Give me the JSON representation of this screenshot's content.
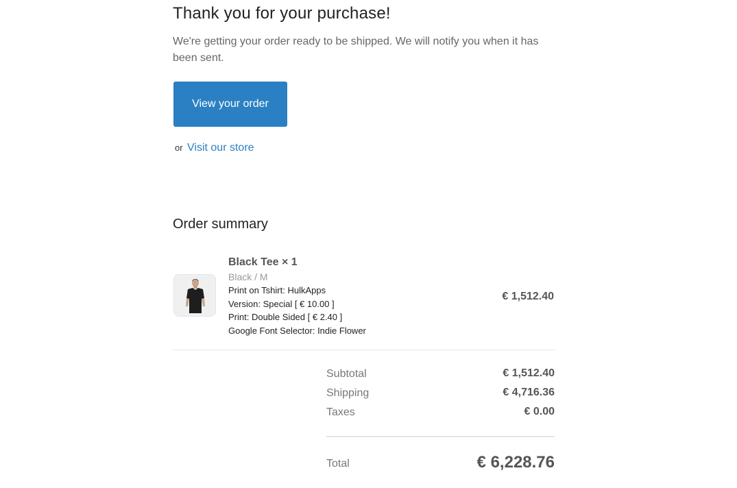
{
  "header": {
    "title": "Thank you for your purchase!",
    "message": "We're getting your order ready to be shipped. We will notify you when it has been sent."
  },
  "actions": {
    "view_order_label": "View your order",
    "or_text": "or",
    "visit_store_label": "Visit our store"
  },
  "summary": {
    "title": "Order summary",
    "items": [
      {
        "image_icon": "black-tshirt-product-image",
        "title": "Black Tee × 1",
        "variant": "Black / M",
        "properties": [
          "Print on Tshirt: HulkApps",
          "Version: Special [ € 10.00 ]",
          "Print: Double Sided [ € 2.40 ]",
          "Google Font Selector: Indie Flower"
        ],
        "price": "€ 1,512.40"
      }
    ],
    "totals": [
      {
        "label": "Subtotal",
        "value": "€ 1,512.40"
      },
      {
        "label": "Shipping",
        "value": "€ 4,716.36"
      },
      {
        "label": "Taxes",
        "value": "€ 0.00"
      }
    ],
    "grand_total": {
      "label": "Total",
      "value": "€ 6,228.76"
    }
  },
  "colors": {
    "accent": "#2b80c3",
    "divider": "#e5e5e5"
  }
}
